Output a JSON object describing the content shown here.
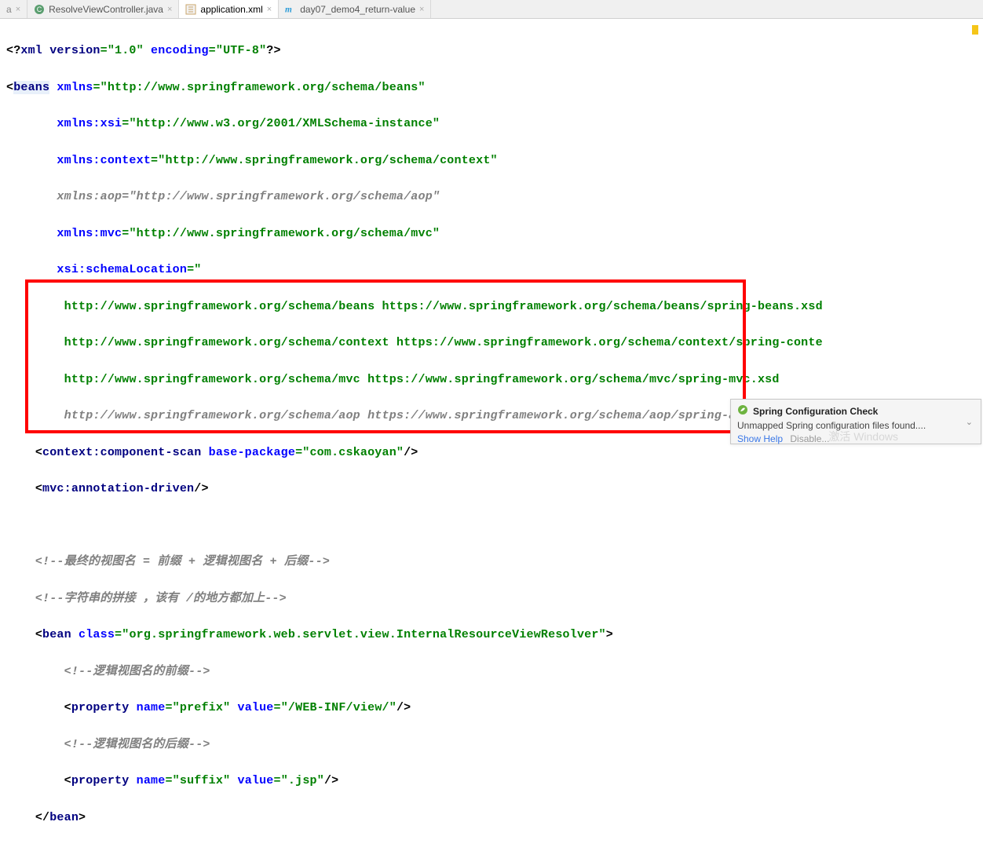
{
  "tabs": {
    "t0": {
      "label": "a"
    },
    "t1": {
      "label": "ResolveViewController.java"
    },
    "t2": {
      "label": "application.xml"
    },
    "t3": {
      "label": "day07_demo4_return-value"
    }
  },
  "code": {
    "l1": {
      "a": "<?",
      "b": "xml version",
      "c": "=",
      "d": "\"1.0\"",
      "e": " encoding",
      "f": "=",
      "g": "\"UTF-8\"",
      "h": "?>"
    },
    "l2": {
      "a": "<",
      "b": "beans",
      "c": " xmlns",
      "d": "=",
      "e": "\"http://www.springframework.org/schema/beans\""
    },
    "l3": {
      "a": "xmlns:xsi",
      "b": "=",
      "c": "\"http://www.w3.org/2001/XMLSchema-instance\""
    },
    "l4": {
      "a": "xmlns:context",
      "b": "=",
      "c": "\"http://www.springframework.org/schema/context\""
    },
    "l5": {
      "a": "xmlns:aop=\"http://www.springframework.org/schema/aop\""
    },
    "l6": {
      "a": "xmlns:mvc",
      "b": "=",
      "c": "\"http://www.springframework.org/schema/mvc\""
    },
    "l7": {
      "a": "xsi:schemaLocation",
      "b": "=",
      "c": "\""
    },
    "l8": {
      "a": "http://www.springframework.org/schema/beans https://www.springframework.org/schema/beans/spring-beans.xsd"
    },
    "l9": {
      "a": "http://www.springframework.org/schema/context https://www.springframework.org/schema/context/spring-conte"
    },
    "l10": {
      "a": "http://www.springframework.org/schema/mvc https://www.springframework.org/schema/mvc/spring-mvc.xsd"
    },
    "l11": {
      "a": "http://www.springframework.org/schema/aop https://www.springframework.org/schema/aop/spring-aop.xsd\"",
      "b": ">"
    },
    "l12": {
      "a": "<",
      "b": "context:component-scan",
      "c": " base-package",
      "d": "=",
      "e": "\"com.cskaoyan\"",
      "f": "/>"
    },
    "l13": {
      "a": "<",
      "b": "mvc:annotation-driven",
      "c": "/>"
    },
    "l15": {
      "a": "<!--最终的视图名 = 前缀 + 逻辑视图名 + 后缀-->"
    },
    "l16": {
      "a": "<!--字符串的拼接 ，该有 /的地方都加上-->"
    },
    "l17": {
      "a": "<",
      "b": "bean",
      "c": " class",
      "d": "=",
      "e": "\"org.springframework.web.servlet.view.InternalResourceViewResolver\"",
      "f": ">"
    },
    "l18": {
      "a": "<!--逻辑视图名的前缀-->"
    },
    "l19": {
      "a": "<",
      "b": "property",
      "c": " name",
      "d": "=",
      "e": "\"prefix\"",
      "f": " value",
      "g": "=",
      "h": "\"/WEB-INF/view/\"",
      "i": "/>"
    },
    "l20": {
      "a": "<!--逻辑视图名的后缀-->"
    },
    "l21": {
      "a": "<",
      "b": "property",
      "c": " name",
      "d": "=",
      "e": "\"suffix\"",
      "f": " value",
      "g": "=",
      "h": "\".jsp\"",
      "i": "/>"
    },
    "l22": {
      "a": "</",
      "b": "bean",
      "c": ">"
    }
  },
  "popup": {
    "title": "Spring Configuration Check",
    "msg": "Unmapped Spring configuration files found....",
    "help": "Show Help",
    "disable": "Disable..."
  },
  "watermark": "激活 Windows"
}
